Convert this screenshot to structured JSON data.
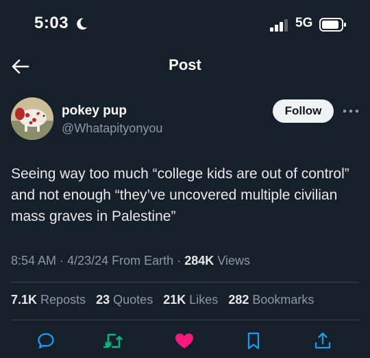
{
  "status_bar": {
    "time": "5:03",
    "network": "5G"
  },
  "nav": {
    "title": "Post"
  },
  "author": {
    "name": "pokey pup",
    "handle": "@Whatapityonyou"
  },
  "follow_label": "Follow",
  "post": {
    "text": "Seeing way too much “college kids are out of control” and not enough “they’ve uncovered multiple civilian mass graves in Palestine”"
  },
  "meta": {
    "time": "8:54 AM",
    "separator": "·",
    "date": "4/23/24",
    "location": "From Earth",
    "views_count": "284K",
    "views_label": "Views"
  },
  "stats": [
    {
      "count": "7.1K",
      "label": "Reposts"
    },
    {
      "count": "23",
      "label": "Quotes"
    },
    {
      "count": "21K",
      "label": "Likes"
    },
    {
      "count": "282",
      "label": "Bookmarks"
    }
  ],
  "actions": [
    {
      "icon": "reply-icon",
      "color": "#1d9bf0"
    },
    {
      "icon": "repost-icon",
      "color": "#00ba7c"
    },
    {
      "icon": "like-icon",
      "color": "#f91880"
    },
    {
      "icon": "bookmark-icon",
      "color": "#1d9bf0"
    },
    {
      "icon": "share-icon",
      "color": "#1d9bf0"
    }
  ]
}
